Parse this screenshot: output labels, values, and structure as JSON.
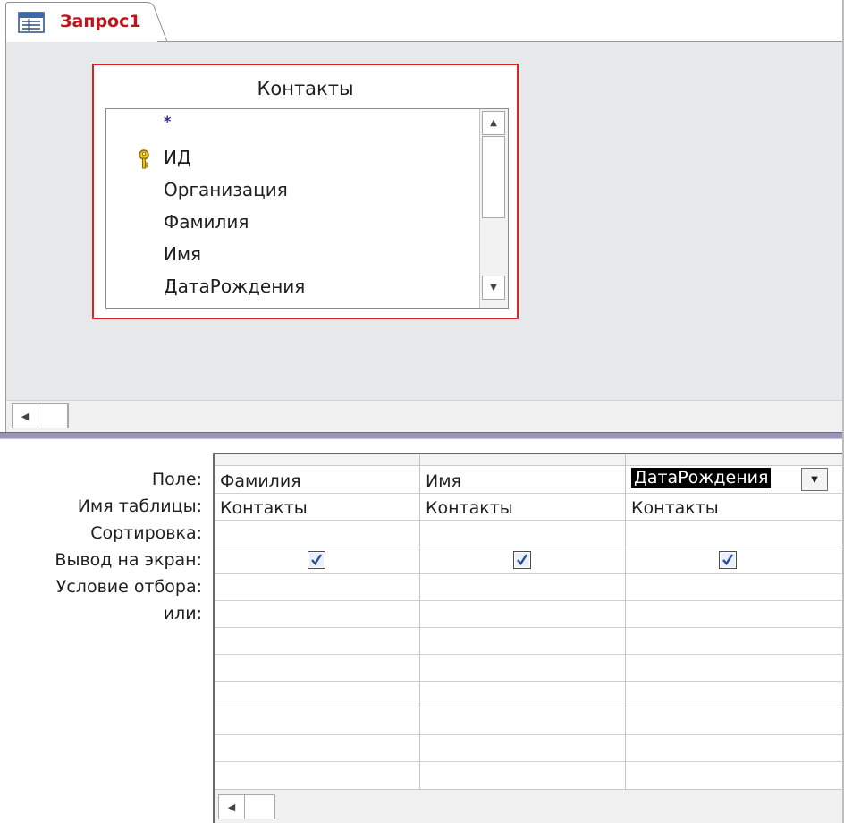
{
  "tab": {
    "title": "Запрос1",
    "icon": "query-icon"
  },
  "table_box": {
    "title": "Контакты",
    "fields": [
      {
        "label": "*",
        "primary_key": false
      },
      {
        "label": "ИД",
        "primary_key": true
      },
      {
        "label": "Организация",
        "primary_key": false
      },
      {
        "label": "Фамилия",
        "primary_key": false
      },
      {
        "label": "Имя",
        "primary_key": false
      },
      {
        "label": "ДатаРождения",
        "primary_key": false
      }
    ],
    "key_icon": "key-icon",
    "border_color": "#d9232a"
  },
  "grid": {
    "row_labels": {
      "field": "Поле:",
      "table": "Имя таблицы:",
      "sort": "Сортировка:",
      "show": "Вывод на экран:",
      "criteria": "Условие отбора:",
      "or": "или:"
    },
    "columns": [
      {
        "field": "Фамилия",
        "table": "Контакты",
        "sort": "",
        "show": true,
        "selected": false
      },
      {
        "field": "Имя",
        "table": "Контакты",
        "sort": "",
        "show": true,
        "selected": false
      },
      {
        "field": "ДатаРождения",
        "table": "Контакты",
        "sort": "",
        "show": true,
        "selected": true
      }
    ]
  },
  "icons": {
    "scroll_left": "arrow-left-icon",
    "scroll_up": "arrow-up-icon",
    "scroll_down": "arrow-down-icon",
    "dropdown": "chevron-down-icon",
    "checkbox": "checkmark-icon"
  }
}
